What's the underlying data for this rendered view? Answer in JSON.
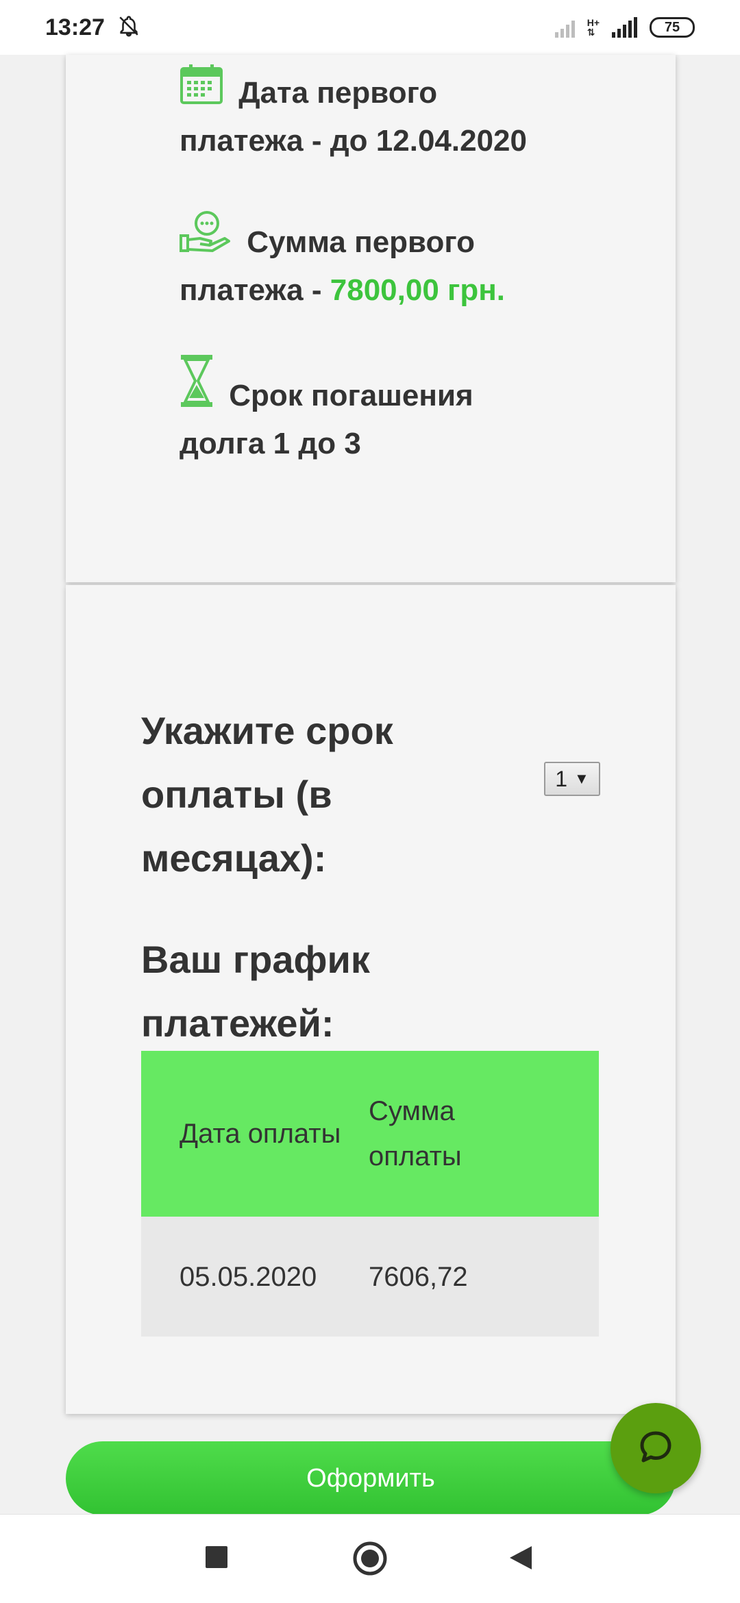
{
  "status_bar": {
    "time": "13:27",
    "network_type": "H+",
    "battery": "75",
    "icons": [
      "bell-off-icon",
      "signal-icon",
      "battery-icon"
    ]
  },
  "loan_info": {
    "first_payment_date_label": "Дата первого платежа - до 12.04.2020",
    "first_payment_amount_label": "Сумма первого платежа - ",
    "first_payment_amount_value": "7800,00 грн.",
    "term_label": "Срок погашения долга 1 до 3"
  },
  "term_select": {
    "label": "Укажите срок оплаты (в месяцах):",
    "selected_value": "1",
    "arrow": "▼"
  },
  "schedule": {
    "title": "Ваш график платежей:",
    "columns": [
      "Дата оплаты",
      "Сумма оплаты"
    ],
    "rows": [
      {
        "date": "05.05.2020",
        "amount": "7606,72"
      }
    ]
  },
  "submit_button": {
    "label": "Оформить"
  },
  "colors": {
    "accent_green": "#3dc43d",
    "table_header": "#66e962",
    "button_green": "#3fcf3c",
    "fab": "#5b9f0f"
  }
}
